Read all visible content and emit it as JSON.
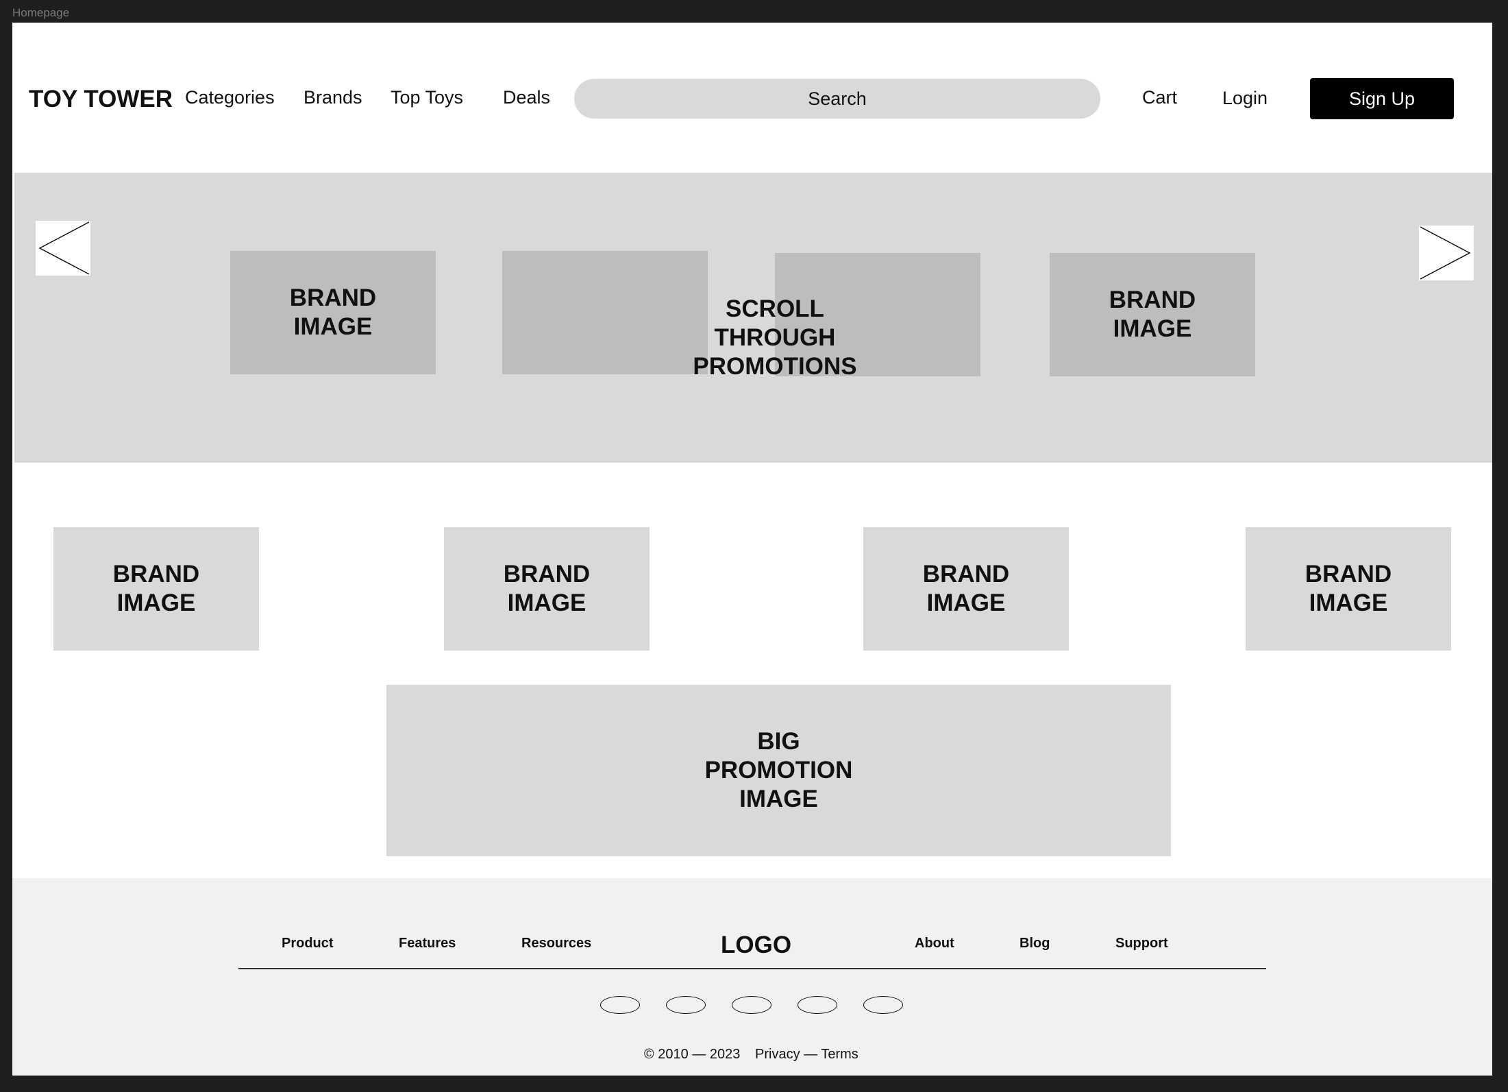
{
  "frame": {
    "label": "Homepage"
  },
  "header": {
    "brand": "TOY TOWER",
    "nav": [
      "Categories",
      "Brands",
      "Top Toys",
      "Deals"
    ],
    "search_placeholder": "Search",
    "cart": "Cart",
    "login": "Login",
    "signup": "Sign Up"
  },
  "carousel": {
    "tiles": [
      "BRAND\nIMAGE",
      "",
      "",
      "BRAND\nIMAGE"
    ],
    "caption": "SCROLL\nTHROUGH\nPROMOTIONS",
    "prev_icon": "chevron-left-icon",
    "next_icon": "chevron-right-icon"
  },
  "brands": {
    "tiles": [
      "BRAND\nIMAGE",
      "BRAND\nIMAGE",
      "BRAND\nIMAGE",
      "BRAND\nIMAGE"
    ]
  },
  "big_promo": "BIG\nPROMOTION\nIMAGE",
  "footer": {
    "links_left": [
      "Product",
      "Features",
      "Resources"
    ],
    "logo": "LOGO",
    "links_right": [
      "About",
      "Blog",
      "Support"
    ],
    "social_icons": [
      "social-icon",
      "social-icon",
      "social-icon",
      "social-icon",
      "social-icon"
    ],
    "copyright": "© 2010 — 2023",
    "privacy": "Privacy",
    "separator": " — ",
    "terms": "Terms"
  }
}
